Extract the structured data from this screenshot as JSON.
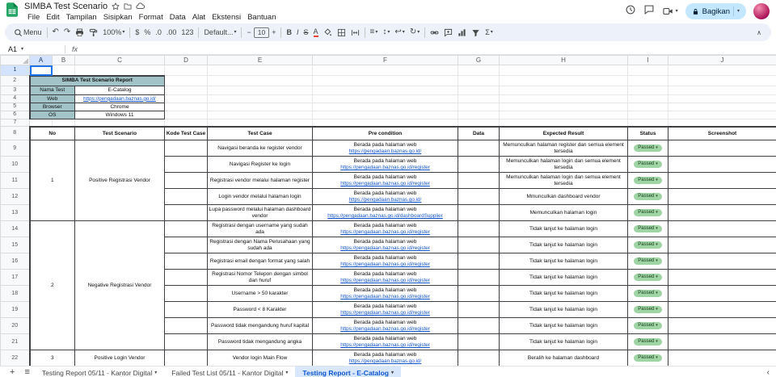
{
  "topbar": {
    "title": "SIMBA Test Scenario",
    "menus": [
      "File",
      "Edit",
      "Tampilan",
      "Sisipkan",
      "Format",
      "Data",
      "Alat",
      "Ekstensi",
      "Bantuan"
    ],
    "share_label": "Bagikan"
  },
  "toolbar": {
    "search_label": "Menu",
    "zoom": "100%",
    "currency": "$",
    "percent": "%",
    "decrease_decimal": ".0",
    "increase_decimal": ".00",
    "number_format": "123",
    "font_name": "Default...",
    "font_size": "10",
    "bold": "B",
    "italic": "I",
    "strikethrough": "S",
    "text_color": "A",
    "sigma": "Σ"
  },
  "formula_bar": {
    "name_box": "A1",
    "fx_label": "fx"
  },
  "icons": {
    "caret": "▾",
    "undo": "↶",
    "redo": "↷",
    "minus": "−",
    "plus": "+",
    "align": "≡",
    "valign": "↕",
    "wrap": "↩",
    "rotate": "↻",
    "collapse": "∧",
    "add_sheet": "+",
    "all_sheets": "≡",
    "chevron_left": "‹"
  },
  "grid": {
    "columns": [
      "A",
      "B",
      "C",
      "D",
      "E",
      "F",
      "G",
      "H",
      "I",
      "J"
    ],
    "row_numbers": [
      "1",
      "2",
      "3",
      "4",
      "5",
      "6",
      "7",
      "8",
      "9",
      "10",
      "11",
      "12",
      "13",
      "14",
      "15",
      "16",
      "17",
      "18",
      "19",
      "20",
      "21",
      "22"
    ]
  },
  "info_table": {
    "title": "SIMBA Test Scenario Report",
    "rows": [
      {
        "label": "Nama Test",
        "value": "E-Catalog"
      },
      {
        "label": "Web",
        "value": "https://pengadaan.baznas.go.id/"
      },
      {
        "label": "Browser",
        "value": "Chrome"
      },
      {
        "label": "OS",
        "value": "Windows 11"
      }
    ]
  },
  "report": {
    "headers": [
      "No",
      "Test Scenario",
      "Kode Test Case",
      "Test Case",
      "Pre condition",
      "Data",
      "Expected Result",
      "Status",
      "Screenshot"
    ],
    "groups": [
      {
        "no": "1",
        "scenario": "Positive Registrasi Vendor"
      },
      {
        "no": "2",
        "scenario": "Negative Registrasi Vendor"
      },
      {
        "no": "3",
        "scenario": "Positive Login Vendor"
      }
    ],
    "rows": [
      {
        "test_case": "Navigasi beranda ke register vendor",
        "pre": "Berada pada halaman web",
        "link": "https://pengadaan.baznas.go.id/",
        "expected": "Memunculkan halaman register dan semua element tersedia",
        "status": "Passed"
      },
      {
        "test_case": "Navigasi Register ke login",
        "pre": "Berada pada halaman web",
        "link": "https://pengadaan.baznas.go.id/register",
        "expected": "Memunculkan halaman login dan semua element tersedia",
        "status": "Passed"
      },
      {
        "test_case": "Registrasi vendor melalui halaman register",
        "pre": "Berada pada halaman web",
        "link": "https://pengadaan.baznas.go.id/register",
        "expected": "Memunculkan halaman login dan semua element tersedia",
        "status": "Passed"
      },
      {
        "test_case": "Login vendor melalui halaman login",
        "pre": "Berada pada halaman web",
        "link": "https://pengadaan.baznas.go.id/",
        "expected": "Mmunculkan dashboard vendor",
        "status": "Passed"
      },
      {
        "test_case": "Lupa password melalui halaman dashboard vendor",
        "pre": "Berada pada halaman web",
        "link": "https://pengadaan.baznas.go.id/dashboardSupplier",
        "expected": "Memunculkan halaman login",
        "status": "Passed"
      },
      {
        "test_case": "Registrasi dengan username yang sudah ada",
        "pre": "Berada pada halaman web",
        "link": "https://pengadaan.baznas.go.id/register",
        "expected": "Tidak lanjut ke halaman login",
        "status": "Passed"
      },
      {
        "test_case": "Registrasi dengan Nama Perusahaan yang sudah ada",
        "pre": "Berada pada halaman web",
        "link": "https://pengadaan.baznas.go.id/register",
        "expected": "Tidak lanjut ke halaman login",
        "status": "Passed"
      },
      {
        "test_case": "Registrasi email dengan format yang salah",
        "pre": "Berada pada halaman web",
        "link": "https://pengadaan.baznas.go.id/register",
        "expected": "Tidak lanjut ke halaman login",
        "status": "Passed"
      },
      {
        "test_case": "Registrasi Nomor Telepon dengan simbol dan huruf",
        "pre": "Berada pada halaman web",
        "link": "https://pengadaan.baznas.go.id/register",
        "expected": "Tidak lanjut ke halaman login",
        "status": "Passed"
      },
      {
        "test_case": "Username > 50 karakter",
        "pre": "Berada pada halaman web",
        "link": "https://pengadaan.baznas.go.id/register",
        "expected": "Tidak lanjut ke halaman login",
        "status": "Passed"
      },
      {
        "test_case": "Password < 8 Karakter",
        "pre": "Berada pada halaman web",
        "link": "https://pengadaan.baznas.go.id/register",
        "expected": "Tidak lanjut ke halaman login",
        "status": "Passed"
      },
      {
        "test_case": "Password tidak mengandung huruf kapital",
        "pre": "Berada pada halaman web",
        "link": "https://pengadaan.baznas.go.id/register",
        "expected": "Tidak lanjut ke halaman login",
        "status": "Passed"
      },
      {
        "test_case": "Password tidak mengandung angka",
        "pre": "Berada pada halaman web",
        "link": "https://pengadaan.baznas.go.id/register",
        "expected": "Tidak lanjut ke halaman login",
        "status": "Passed"
      },
      {
        "test_case": "Vendor login Main Flow",
        "pre": "Berada pada halaman web",
        "link": "https://pengadaan.baznas.go.id/",
        "expected": "Beralih ke halaman dashboard",
        "status": "Passed"
      }
    ]
  },
  "tabbar": {
    "tabs": [
      {
        "label": "Testing Report 05/11 - Kantor Digital",
        "active": false
      },
      {
        "label": "Failed Test List 05/11 - Kantor Digital",
        "active": false
      },
      {
        "label": "Testing Report - E-Catalog",
        "active": true
      }
    ]
  },
  "colors": {
    "header_teal": "#a2c4c9",
    "status_passed_bg": "#9fd4a4",
    "link_blue": "#1155cc",
    "active_cell_blue": "#1a73e8",
    "share_button_bg": "#c2e7ff",
    "active_tab_blue": "#0b57d0",
    "logo_green": "#21a464",
    "toolbar_bg": "#edf2fa"
  }
}
